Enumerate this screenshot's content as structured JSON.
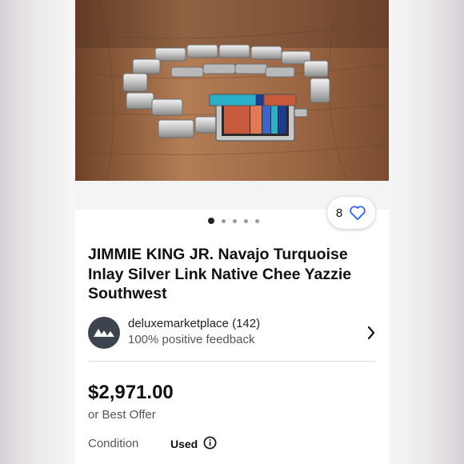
{
  "listing": {
    "watch_count": "8",
    "title": "JIMMIE KING JR. Navajo Turquoise Inlay Silver Link Native Chee Yazzie Southwest",
    "seller": {
      "name": "deluxemarketplace (142)",
      "feedback": "100% positive feedback"
    },
    "price": "$2,971.00",
    "offer": "or Best Offer",
    "condition": {
      "label": "Condition",
      "value": "Used"
    },
    "carousel": {
      "total_images": 5,
      "active_index": 0
    }
  },
  "icons": {
    "watch": "heart-outline-icon",
    "seller_avatar": "seller-logo-icon",
    "seller_chevron": "chevron-right-icon",
    "condition_info": "info-circle-icon"
  },
  "colors": {
    "heart": "#3665f3",
    "text": "#111111",
    "secondary_text": "#555555"
  }
}
